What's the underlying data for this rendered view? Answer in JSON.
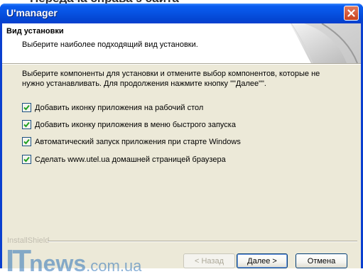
{
  "background": {
    "heading": "Передача справа з сайта"
  },
  "window": {
    "title": "U'manager"
  },
  "header": {
    "title": "Вид установки",
    "subtitle": "Выберите наиболее подходящий вид установки."
  },
  "description": "Выберите компоненты для установки и отмените выбор компонентов, которые не нужно устанавливать. Для продолжения нажмите кнопку \"\"Далее\"\".",
  "options": [
    {
      "label": "Добавить иконку приложения на рабочий стол",
      "checked": true
    },
    {
      "label": "Добавить иконку приложения в меню быстрого запуска",
      "checked": true
    },
    {
      "label": "Автоматический запуск приложения при старте Windows",
      "checked": true
    },
    {
      "label": "Сделать www.utel.ua домашней страницей браузера",
      "checked": true
    }
  ],
  "footer": {
    "brand": "InstallShield",
    "back_label": "< Назад",
    "next_label": "Далее >",
    "cancel_label": "Отмена"
  },
  "watermark": {
    "part1": "IT",
    "part2": "news",
    "part3": ".com.ua"
  },
  "icons": {
    "close": "close-icon",
    "check": "checkmark-icon"
  },
  "colors": {
    "titlebar": "#0a5cf0",
    "client": "#ece9d8",
    "close": "#c8421e",
    "check": "#21a121"
  }
}
